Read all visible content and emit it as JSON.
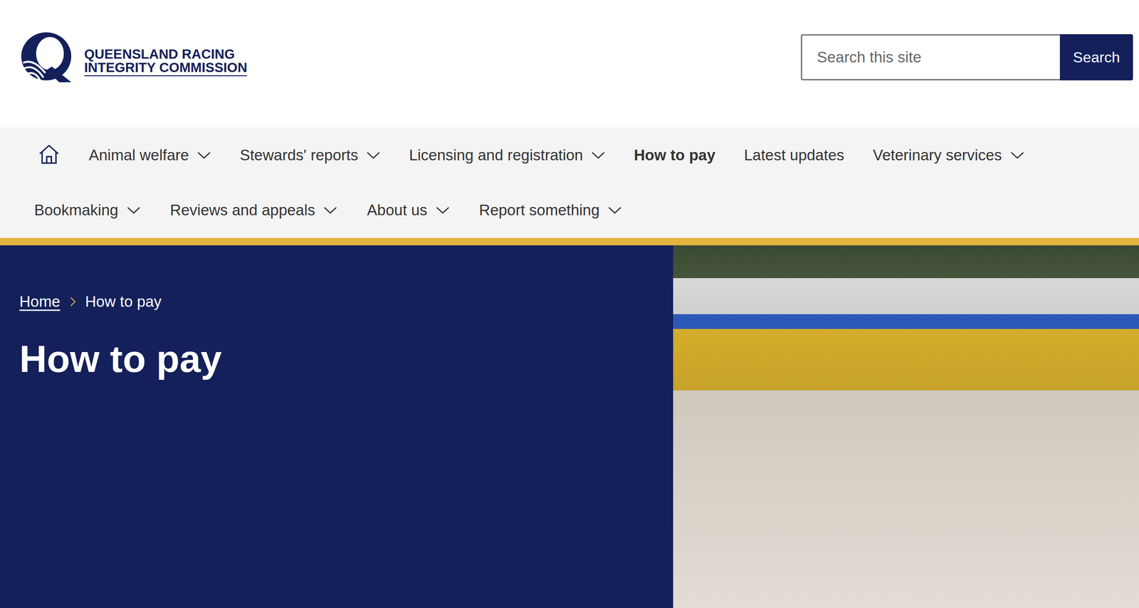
{
  "logo": {
    "line1": "QUEENSLAND RACING",
    "line2": "INTEGRITY COMMISSION"
  },
  "search": {
    "placeholder": "Search this site",
    "button": "Search"
  },
  "nav": {
    "items": [
      {
        "label": "Animal welfare",
        "hasMenu": true,
        "selected": false
      },
      {
        "label": "Stewards' reports",
        "hasMenu": true,
        "selected": false
      },
      {
        "label": "Licensing and registration",
        "hasMenu": true,
        "selected": false
      },
      {
        "label": "How to pay",
        "hasMenu": false,
        "selected": true
      },
      {
        "label": "Latest updates",
        "hasMenu": false,
        "selected": false
      },
      {
        "label": "Veterinary services",
        "hasMenu": true,
        "selected": false
      },
      {
        "label": "Bookmaking",
        "hasMenu": true,
        "selected": false
      },
      {
        "label": "Reviews and appeals",
        "hasMenu": true,
        "selected": false
      },
      {
        "label": "About us",
        "hasMenu": true,
        "selected": false
      },
      {
        "label": "Report something",
        "hasMenu": true,
        "selected": false
      }
    ]
  },
  "breadcrumb": [
    {
      "label": "Home",
      "link": true
    },
    {
      "label": "How to pay",
      "link": false
    }
  ],
  "page": {
    "title": "How to pay"
  }
}
